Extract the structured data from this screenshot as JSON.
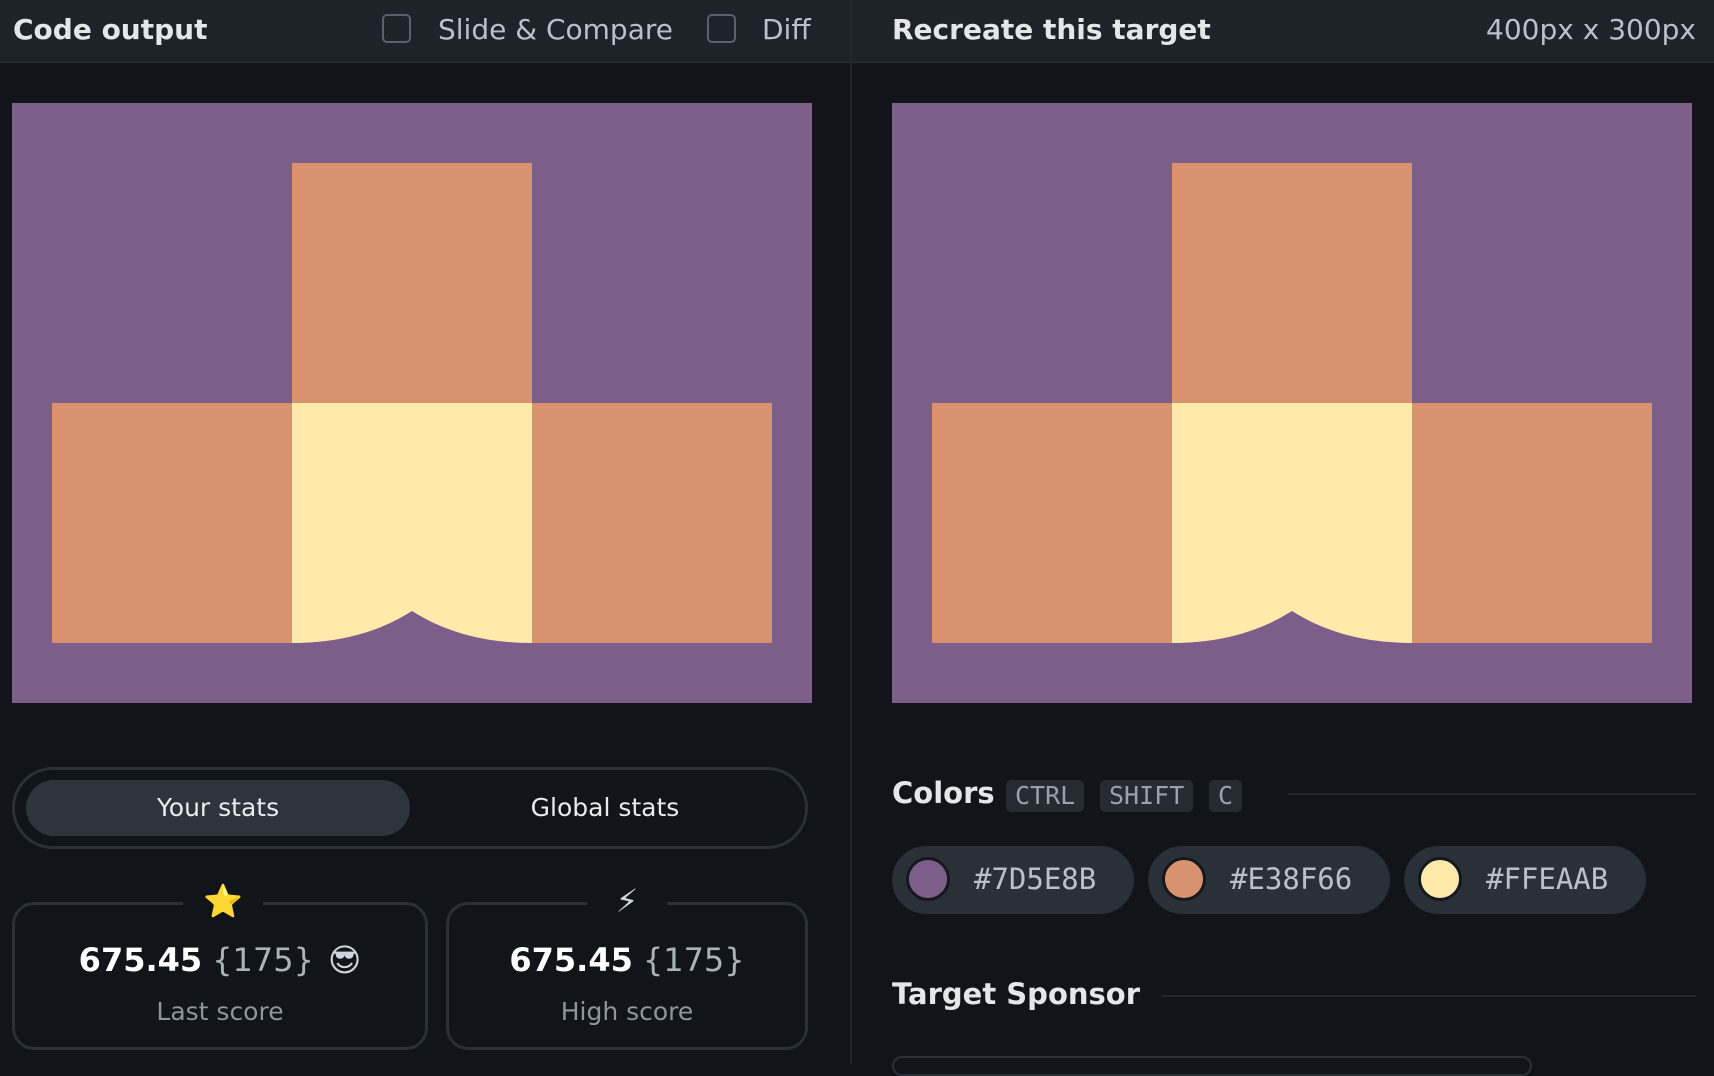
{
  "left_panel": {
    "title": "Code output",
    "slide_compare_label": "Slide & Compare",
    "diff_label": "Diff",
    "stats_tabs": {
      "your": "Your stats",
      "global": "Global stats"
    },
    "last_score": {
      "icon": "⭐",
      "value": "675.45",
      "count": "{175}",
      "emoji": "😎",
      "label": "Last score"
    },
    "high_score": {
      "icon": "⚡",
      "value": "675.45",
      "count": "{175}",
      "label": "High score"
    }
  },
  "right_panel": {
    "title": "Recreate this target",
    "dimensions": "400px x 300px",
    "colors_title": "Colors",
    "shortcut": [
      "CTRL",
      "SHIFT",
      "C"
    ],
    "colors": [
      {
        "hex": "#7D5E8B",
        "label": "#7D5E8B"
      },
      {
        "hex": "#E38F66",
        "label": "#E38F66"
      },
      {
        "hex": "#FFEAAB",
        "label": "#FFEAAB"
      }
    ],
    "sponsor_title": "Target Sponsor"
  },
  "theme": {
    "background": "#7D5E8B",
    "blocks": "#D8926E",
    "center": "#FFEAAB",
    "app_bg": "#111418"
  }
}
